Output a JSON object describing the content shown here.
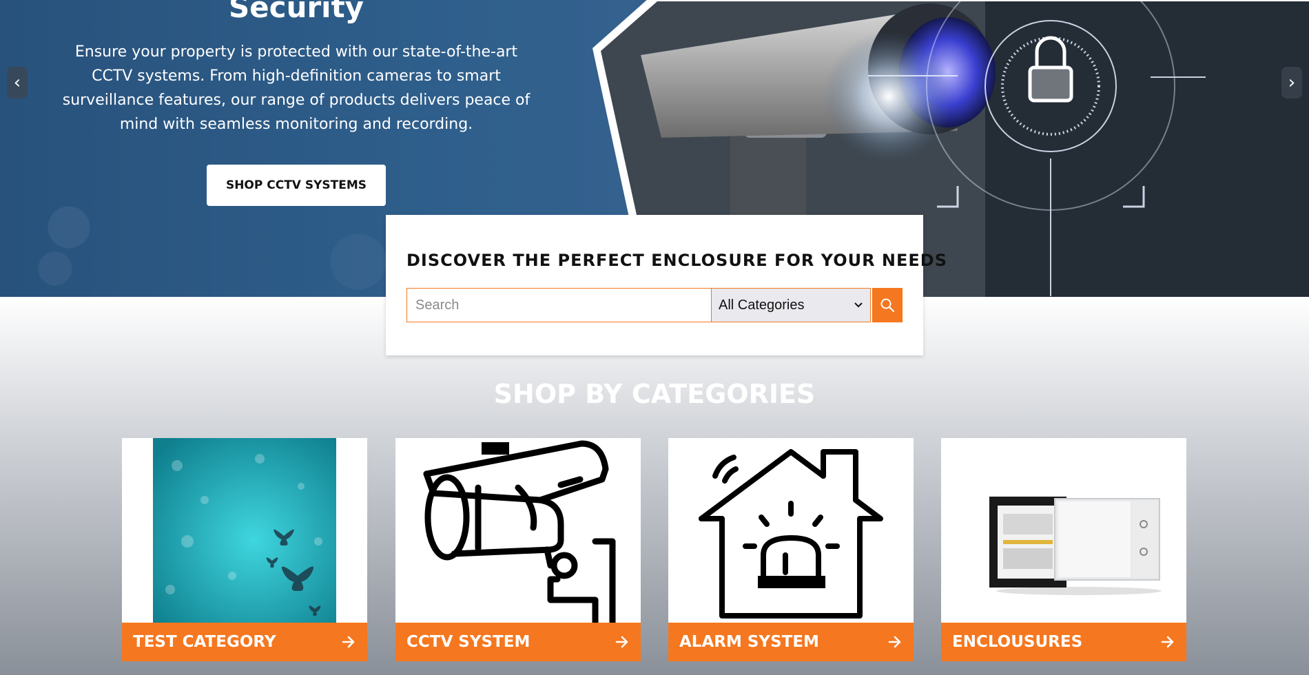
{
  "hero": {
    "title": "Security",
    "description": "Ensure your property is protected with our state-of-the-art CCTV systems. From high-definition cameras to smart surveillance features, our range of products delivers peace of mind with seamless monitoring and recording.",
    "cta_label": "SHOP CCTV SYSTEMS",
    "prev_glyph": "‹",
    "next_glyph": "›"
  },
  "search": {
    "heading": "DISCOVER THE PERFECT ENCLOSURE FOR YOUR NEEDS",
    "placeholder": "Search",
    "category_selected": "All Categories"
  },
  "categories": {
    "title": "SHOP BY CATEGORIES",
    "items": [
      {
        "label": "TEST CATEGORY",
        "icon": "butterfly-image"
      },
      {
        "label": "CCTV SYSTEM",
        "icon": "cctv-camera-icon"
      },
      {
        "label": "ALARM SYSTEM",
        "icon": "alarm-house-icon"
      },
      {
        "label": "ENCLOUSURES",
        "icon": "enclosure-product-image"
      }
    ]
  },
  "colors": {
    "accent": "#f5771f",
    "hero_blue": "#2f5f8c"
  }
}
